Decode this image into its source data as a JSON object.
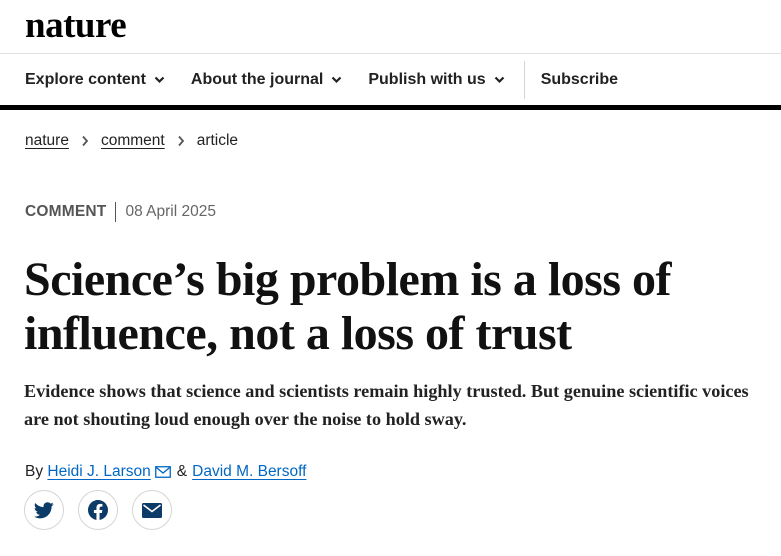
{
  "brand": {
    "logo_text": "nature"
  },
  "nav": {
    "items": [
      {
        "label": "Explore content"
      },
      {
        "label": "About the journal"
      },
      {
        "label": "Publish with us"
      }
    ],
    "subscribe_label": "Subscribe"
  },
  "breadcrumb": {
    "items": [
      {
        "label": "nature"
      },
      {
        "label": "comment"
      },
      {
        "label": "article"
      }
    ]
  },
  "article": {
    "type": "COMMENT",
    "date": "08 April 2025",
    "title": "Science’s big problem is a loss of influence, not a loss of trust",
    "standfirst": "Evidence shows that science and scientists remain highly trusted. But genuine scientific voices are not shouting loud enough over the noise to hold sway.",
    "by_label": "By",
    "authors": [
      {
        "name": "Heidi J. Larson"
      },
      {
        "name": "David M. Bersoff"
      }
    ],
    "author_separator": "&"
  },
  "share": {
    "icons": [
      "twitter-icon",
      "facebook-icon",
      "email-icon"
    ]
  },
  "colors": {
    "link_blue": "#0067c5",
    "text": "#222222",
    "nav_rule": "#000000"
  }
}
